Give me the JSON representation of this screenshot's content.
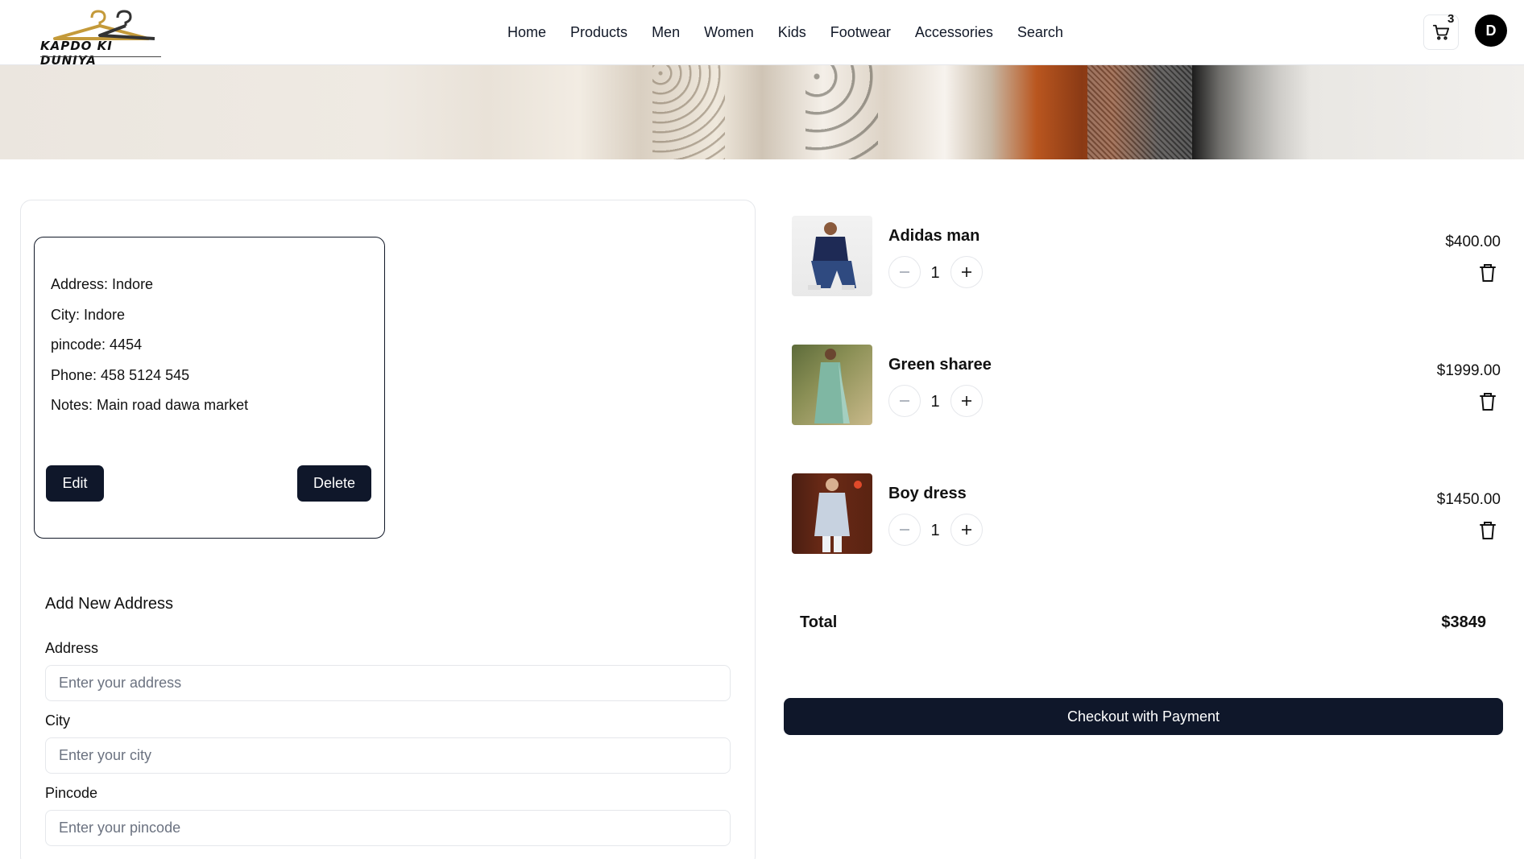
{
  "brand": {
    "logo_text": "KAPDO KI DUNIYA"
  },
  "nav": [
    "Home",
    "Products",
    "Men",
    "Women",
    "Kids",
    "Footwear",
    "Accessories",
    "Search"
  ],
  "header": {
    "cart_count": "3",
    "avatar_initial": "D"
  },
  "saved_address": {
    "address": "Address: Indore",
    "city": "City: Indore",
    "pincode": "pincode: 4454",
    "phone": "Phone: 458 5124 545",
    "notes": "Notes: Main road dawa market",
    "edit_label": "Edit",
    "delete_label": "Delete"
  },
  "new_address": {
    "title": "Add New Address",
    "fields": [
      {
        "label": "Address",
        "placeholder": "Enter your address"
      },
      {
        "label": "City",
        "placeholder": "Enter your city"
      },
      {
        "label": "Pincode",
        "placeholder": "Enter your pincode"
      }
    ]
  },
  "cart": {
    "items": [
      {
        "name": "Adidas man",
        "qty": "1",
        "price": "$400.00"
      },
      {
        "name": "Green sharee",
        "qty": "1",
        "price": "$1999.00"
      },
      {
        "name": "Boy dress",
        "qty": "1",
        "price": "$1450.00"
      }
    ],
    "total_label": "Total",
    "total_value": "$3849",
    "checkout_label": "Checkout with Payment"
  },
  "colors": {
    "primary_dark": "#0f172a",
    "border": "#e5e7eb"
  },
  "icons": {
    "cart": "cart-icon",
    "minus": "minus-icon",
    "plus": "plus-icon",
    "trash": "trash-icon"
  }
}
